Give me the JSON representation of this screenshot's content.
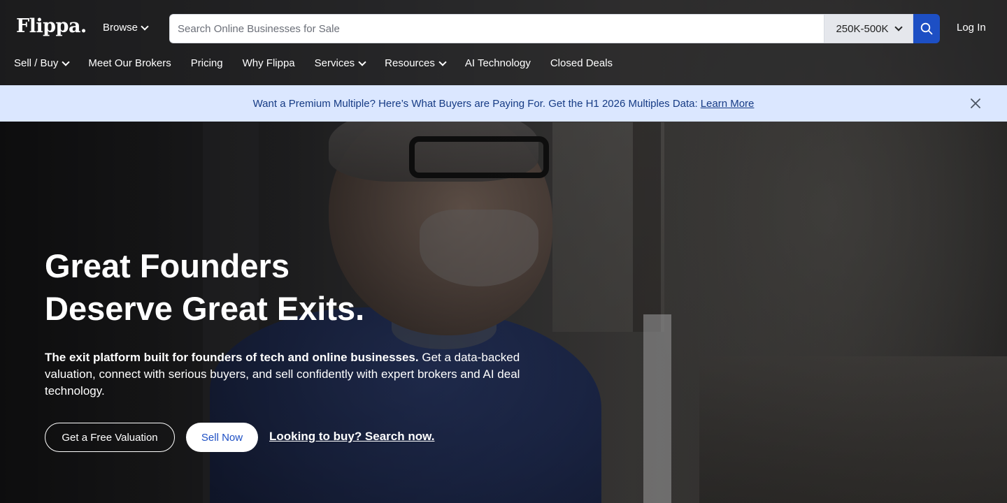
{
  "brand": {
    "logo_text": "Flippa.",
    "accent_color": "#1d4fc4",
    "banner_bg": "#dbe7ff"
  },
  "header": {
    "browse_label": "Browse",
    "search": {
      "placeholder": "Search Online Businesses for Sale",
      "value": ""
    },
    "range_selected": "250K-500K",
    "search_icon": "search-icon",
    "login_label": "Log In"
  },
  "nav": {
    "items": [
      {
        "label": "Sell / Buy",
        "dropdown": true
      },
      {
        "label": "Meet Our Brokers",
        "dropdown": false
      },
      {
        "label": "Pricing",
        "dropdown": false
      },
      {
        "label": "Why Flippa",
        "dropdown": false
      },
      {
        "label": "Services",
        "dropdown": true
      },
      {
        "label": "Resources",
        "dropdown": true
      },
      {
        "label": "AI Technology",
        "dropdown": false
      },
      {
        "label": "Closed Deals",
        "dropdown": false
      }
    ]
  },
  "banner": {
    "text": "Want a Premium Multiple? Here’s What Buyers are Paying For. Get the H1 2026 Multiples Data:",
    "link_label": "Learn More",
    "close_icon": "close-icon"
  },
  "hero": {
    "title_line1": "Great Founders",
    "title_line2": "Deserve Great Exits.",
    "desc_bold": "The exit platform built for founders of tech and online businesses.",
    "desc_rest": " Get a data-backed valuation, connect with serious buyers, and sell confidently with expert brokers and AI deal technology.",
    "cta_valuation": "Get a Free Valuation",
    "cta_sell": "Sell Now",
    "cta_buy_link": "Looking to buy? Search now."
  }
}
